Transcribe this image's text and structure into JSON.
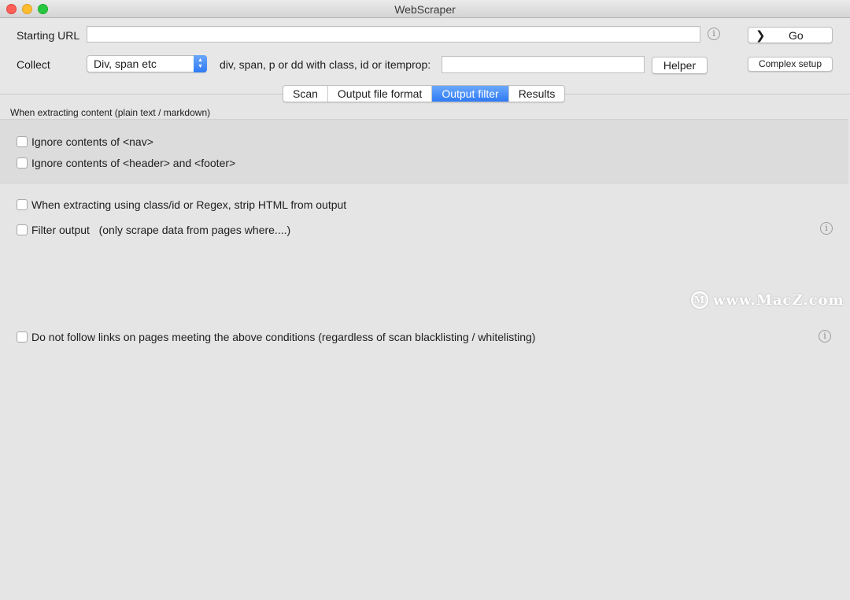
{
  "window": {
    "title": "WebScraper"
  },
  "url_row": {
    "label": "Starting URL",
    "value": "",
    "go_label": "Go",
    "go_chevron": "chevron-right-icon"
  },
  "collect_row": {
    "label": "Collect",
    "selected": "Div, span etc",
    "hint": "div, span, p or dd with class, id or itemprop:",
    "value": "",
    "helper_label": "Helper",
    "complex_label": "Complex setup"
  },
  "tabs": [
    {
      "label": "Scan",
      "active": false
    },
    {
      "label": "Output file format",
      "active": false
    },
    {
      "label": "Output filter",
      "active": true
    },
    {
      "label": "Results",
      "active": false
    }
  ],
  "output_filter": {
    "section_label": "When extracting content (plain text / markdown)",
    "options": [
      {
        "label": "Ignore contents of <nav>",
        "checked": false
      },
      {
        "label": "Ignore contents of <header> and <footer>",
        "checked": false
      },
      {
        "label": "When extracting using class/id or Regex, strip HTML from output",
        "checked": false
      },
      {
        "label": "Filter output   (only scrape data from pages where....)",
        "checked": false
      },
      {
        "label": "Do not follow links on pages meeting the above conditions (regardless of scan blacklisting / whitelisting)",
        "checked": false
      }
    ]
  },
  "watermark": {
    "text": "www.MacZ.com"
  },
  "colors": {
    "accent": "#2f7af5",
    "background": "#e7e7e7"
  }
}
